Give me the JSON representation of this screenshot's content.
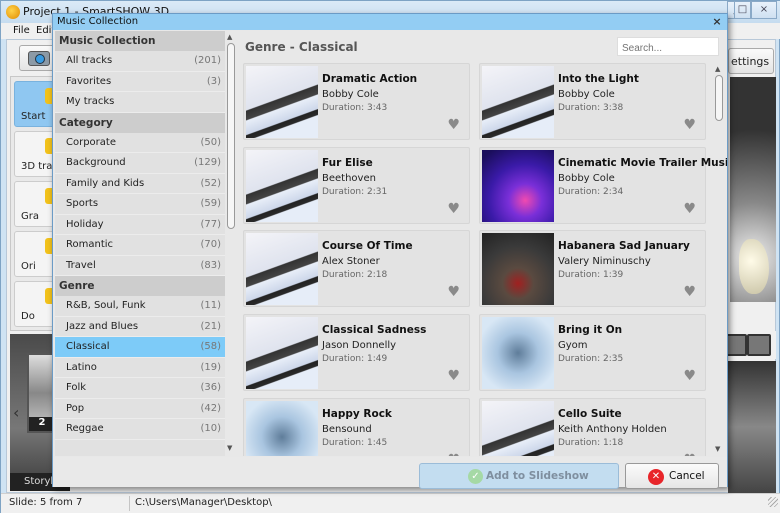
{
  "app": {
    "title": "Project 1 - SmartSHOW 3D",
    "window_controls": [
      "_",
      "□",
      "×"
    ],
    "menu": [
      "File",
      "Edit"
    ],
    "left_tabs": [
      {
        "label": "Start",
        "selected": true,
        "icon": "star-icon"
      },
      {
        "label": "3D tra",
        "selected": false,
        "icon": "3d-icon"
      },
      {
        "label": "Gra",
        "selected": false,
        "icon": "gradient-icon"
      },
      {
        "label": "Ori",
        "selected": false,
        "icon": "ornament-icon"
      },
      {
        "label": "Do",
        "selected": false,
        "icon": "document-icon"
      }
    ],
    "settings_label": "ettings",
    "storyboard_tab": "Storyb",
    "storyboard_slide_number": "2",
    "status": {
      "slide": "Slide: 5 from 7",
      "path": "C:\\Users\\Manager\\Desktop\\"
    }
  },
  "dialog": {
    "title": "Music Collection",
    "sidebar": {
      "sections": [
        {
          "title": "Music Collection",
          "items": [
            {
              "label": "All tracks",
              "count": "(201)"
            },
            {
              "label": "Favorites",
              "count": "(3)"
            },
            {
              "label": "My tracks",
              "count": ""
            }
          ]
        },
        {
          "title": "Category",
          "items": [
            {
              "label": "Corporate",
              "count": "(50)"
            },
            {
              "label": "Background",
              "count": "(129)"
            },
            {
              "label": "Family and Kids",
              "count": "(52)"
            },
            {
              "label": "Sports",
              "count": "(59)"
            },
            {
              "label": "Holiday",
              "count": "(77)"
            },
            {
              "label": "Romantic",
              "count": "(70)"
            },
            {
              "label": "Travel",
              "count": "(83)"
            }
          ]
        },
        {
          "title": "Genre",
          "items": [
            {
              "label": "R&B, Soul, Funk",
              "count": "(11)"
            },
            {
              "label": "Jazz and Blues",
              "count": "(21)"
            },
            {
              "label": "Classical",
              "count": "(58)",
              "selected": true
            },
            {
              "label": "Latino",
              "count": "(19)"
            },
            {
              "label": "Folk",
              "count": "(36)"
            },
            {
              "label": "Pop",
              "count": "(42)"
            },
            {
              "label": "Reggae",
              "count": "(10)"
            }
          ]
        }
      ]
    },
    "main": {
      "heading": "Genre - Classical",
      "search_placeholder": "Search...",
      "tracks": [
        {
          "title": "Dramatic Action",
          "artist": "Bobby Cole",
          "duration": "Duration: 3:43",
          "thumb": "piano"
        },
        {
          "title": "Into the Light",
          "artist": "Bobby Cole",
          "duration": "Duration: 3:38",
          "thumb": "piano"
        },
        {
          "title": "Fur Elise",
          "artist": "Beethoven",
          "duration": "Duration: 2:31",
          "thumb": "piano"
        },
        {
          "title": "Cinematic Movie Trailer Music",
          "artist": "Bobby Cole",
          "duration": "Duration: 2:34",
          "thumb": "dj"
        },
        {
          "title": "Course Of Time",
          "artist": "Alex Stoner",
          "duration": "Duration: 2:18",
          "thumb": "piano"
        },
        {
          "title": "Habanera Sad January",
          "artist": "Valery Niminuschy",
          "duration": "Duration: 1:39",
          "thumb": "dance"
        },
        {
          "title": "Classical Sadness",
          "artist": "Jason Donnelly",
          "duration": "Duration: 1:49",
          "thumb": "piano"
        },
        {
          "title": "Bring it On",
          "artist": "Gyom",
          "duration": "Duration: 2:35",
          "thumb": "guitar"
        },
        {
          "title": "Happy Rock",
          "artist": "Bensound",
          "duration": "Duration: 1:45",
          "thumb": "guitar"
        },
        {
          "title": "Cello Suite",
          "artist": "Keith Anthony Holden",
          "duration": "Duration: 1:18",
          "thumb": "piano"
        }
      ]
    },
    "footer": {
      "add_label": "Add to Slideshow",
      "cancel_label": "Cancel"
    }
  },
  "colors": {
    "title_bar": "#93cdf3",
    "selected_item": "#7dcbf8",
    "cancel_icon": "#e8252a"
  }
}
